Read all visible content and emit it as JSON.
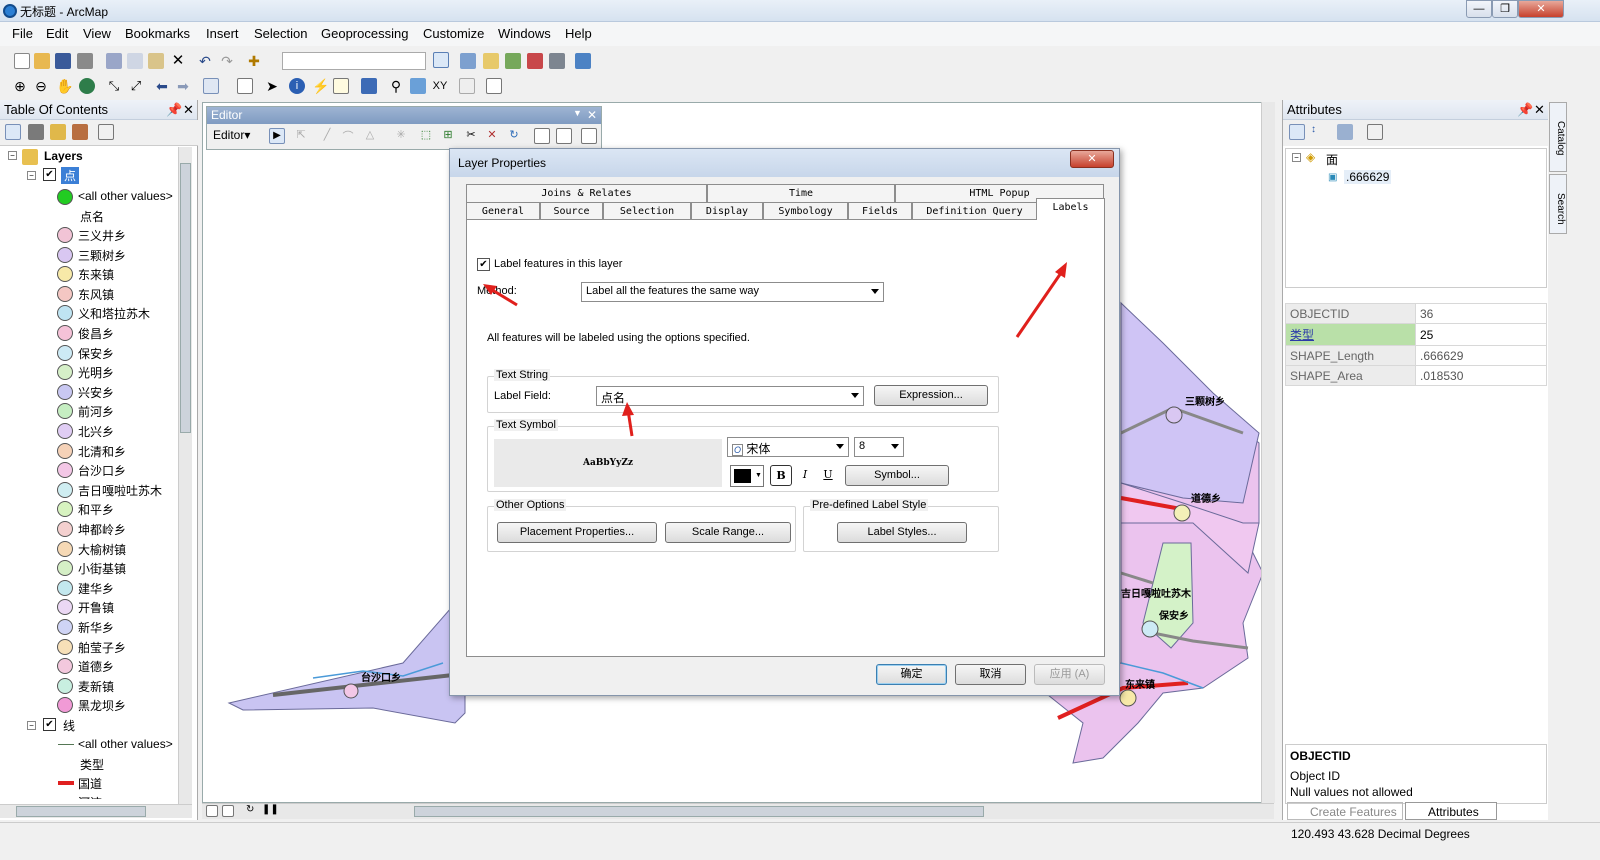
{
  "window": {
    "title": "无标题 - ArcMap"
  },
  "menu": [
    "File",
    "Edit",
    "View",
    "Bookmarks",
    "Insert",
    "Selection",
    "Geoprocessing",
    "Customize",
    "Windows",
    "Help"
  ],
  "toc": {
    "title": "Table Of Contents",
    "root": "Layers",
    "layer1": {
      "name": "点",
      "other": "<all other values>",
      "field": "点名",
      "items": [
        {
          "label": "三义井乡",
          "color": "#f2c4d6"
        },
        {
          "label": "三颗树乡",
          "color": "#d9c7f2"
        },
        {
          "label": "东来镇",
          "color": "#f7e9a8"
        },
        {
          "label": "东风镇",
          "color": "#f4c7c3"
        },
        {
          "label": "义和塔拉苏木",
          "color": "#bfe4f2"
        },
        {
          "label": "俊昌乡",
          "color": "#f5c2d8"
        },
        {
          "label": "保安乡",
          "color": "#cdeaf5"
        },
        {
          "label": "光明乡",
          "color": "#d6f0c8"
        },
        {
          "label": "兴安乡",
          "color": "#c9c8f2"
        },
        {
          "label": "前河乡",
          "color": "#c6eec2"
        },
        {
          "label": "北兴乡",
          "color": "#e0cdf4"
        },
        {
          "label": "北清和乡",
          "color": "#f5d2b8"
        },
        {
          "label": "台沙口乡",
          "color": "#f3c7e6"
        },
        {
          "label": "吉日嘎啦吐苏木",
          "color": "#cfeef2"
        },
        {
          "label": "和平乡",
          "color": "#d7f3c0"
        },
        {
          "label": "坤都岭乡",
          "color": "#f4d0cf"
        },
        {
          "label": "大榆树镇",
          "color": "#f6d9b5"
        },
        {
          "label": "小街基镇",
          "color": "#d5efc6"
        },
        {
          "label": "建华乡",
          "color": "#c3e8ee"
        },
        {
          "label": "开鲁镇",
          "color": "#ebd8f4"
        },
        {
          "label": "新华乡",
          "color": "#cfd4f5"
        },
        {
          "label": "舶莹子乡",
          "color": "#f7e0b8"
        },
        {
          "label": "道德乡",
          "color": "#f3c8dd"
        },
        {
          "label": "麦新镇",
          "color": "#c8efe0"
        },
        {
          "label": "黑龙坝乡",
          "color": "#f19ad6"
        }
      ]
    },
    "layer2": {
      "name": "线",
      "other": "<all other values>",
      "field": "类型",
      "road": "国道",
      "next": "河流"
    }
  },
  "editor": {
    "title": "Editor",
    "menu": "Editor▾"
  },
  "dialog": {
    "title": "Layer Properties",
    "tabs_row1": [
      "Joins & Relates",
      "Time",
      "HTML Popup"
    ],
    "tabs_row2": [
      "General",
      "Source",
      "Selection",
      "Display",
      "Symbology",
      "Fields",
      "Definition Query",
      "Labels"
    ],
    "checkbox": "Label features in this layer",
    "method_label": "Method:",
    "method_value": "Label all the features the same way",
    "info": "All features will be labeled using the options specified.",
    "text_string": "Text String",
    "label_field": "Label Field:",
    "label_field_value": "点名",
    "expression": "Expression...",
    "text_symbol": "Text Symbol",
    "preview": "AaBbYyZz",
    "font": "宋体",
    "size": "8",
    "bold": "B",
    "italic": "I",
    "underline": "U",
    "symbol_btn": "Symbol...",
    "other_options": "Other Options",
    "placement": "Placement Properties...",
    "scale": "Scale Range...",
    "predefined": "Pre-defined Label Style",
    "label_styles": "Label Styles...",
    "ok": "确定",
    "cancel": "取消",
    "apply": "应用 (A)"
  },
  "map_labels": [
    "三颗树乡",
    "道德乡",
    "吉日嘎啦吐苏木",
    "保安乡",
    "东来镇",
    "台沙口乡"
  ],
  "attributes": {
    "title": "Attributes",
    "tree_root": "面",
    "tree_child": ".666629",
    "rows": [
      {
        "k": "OBJECTID",
        "v": "36"
      },
      {
        "k": "类型",
        "v": "25"
      },
      {
        "k": "SHAPE_Length",
        "v": ".666629"
      },
      {
        "k": "SHAPE_Area",
        "v": ".018530"
      }
    ],
    "info_title": "OBJECTID",
    "info_line1": "Object ID",
    "info_line2": "Null values not allowed",
    "tab_create": "Create Features",
    "tab_attr": "Attributes"
  },
  "side_tabs": [
    "Catalog",
    "Search"
  ],
  "status": "120.493  43.628 Decimal Degrees"
}
